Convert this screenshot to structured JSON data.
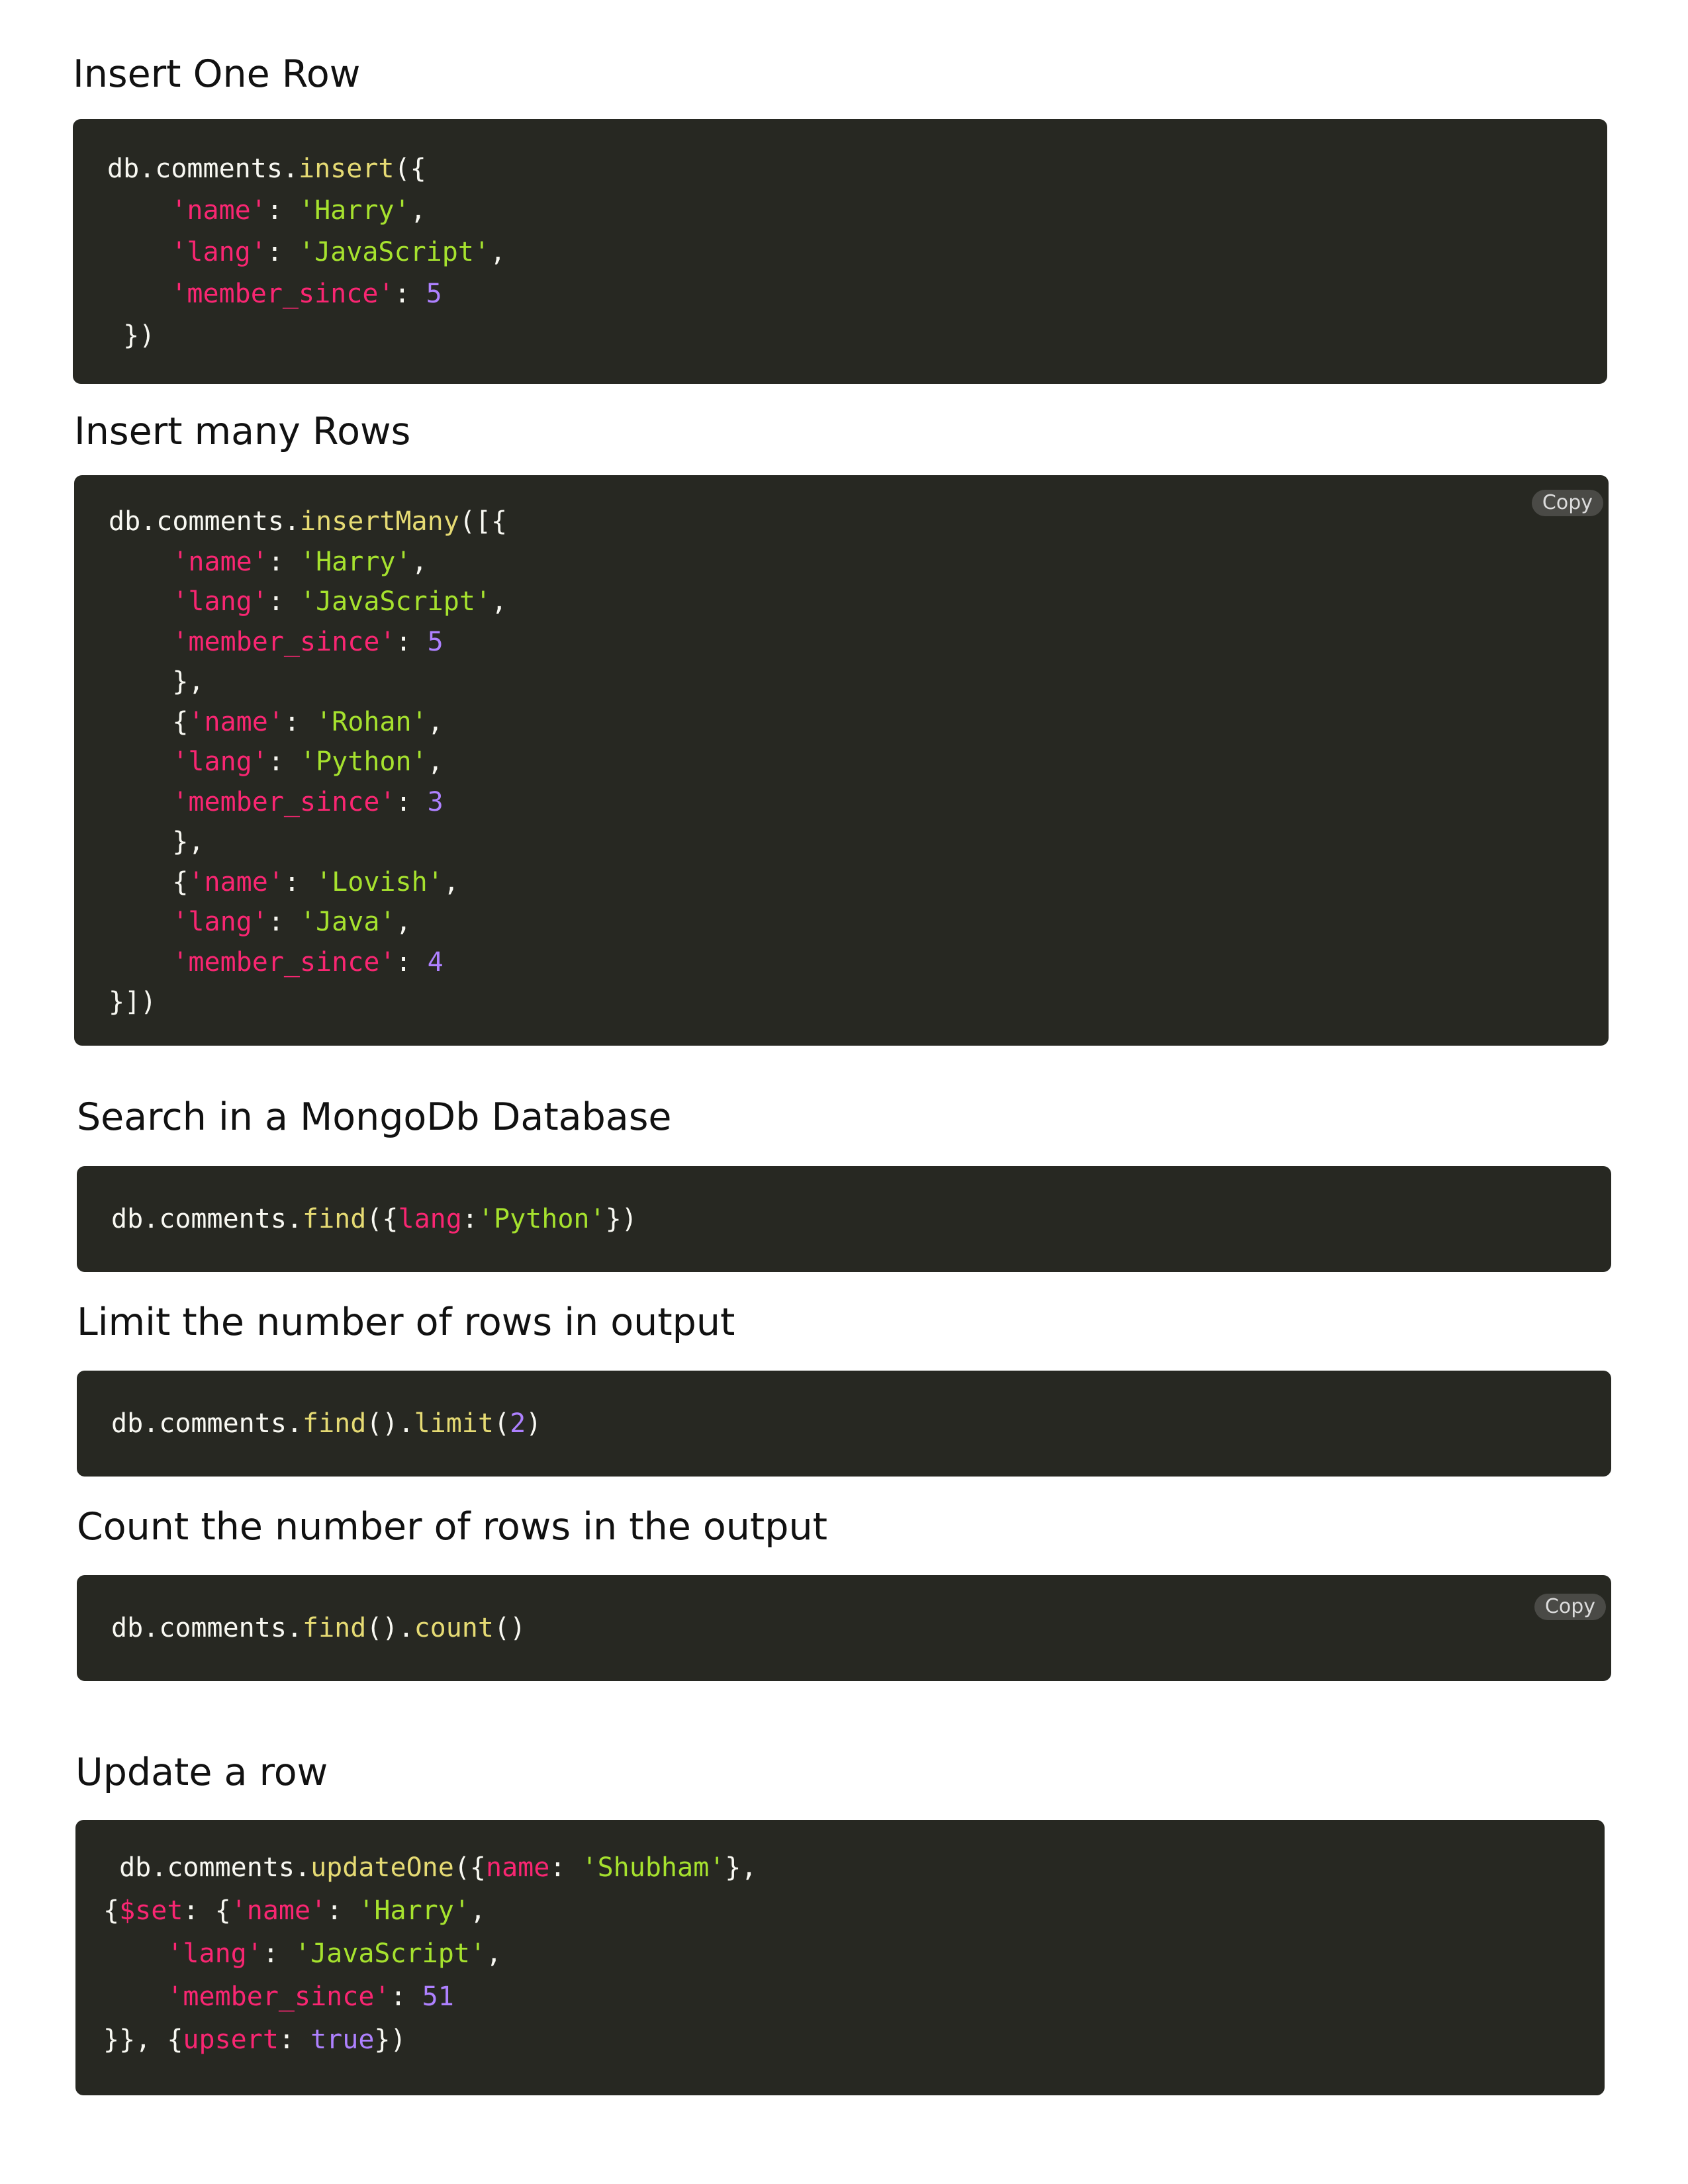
{
  "sections": [
    {
      "title": "Insert One Row",
      "lines": [
        [
          [
            "db.comments.",
            "plain"
          ],
          [
            "insert",
            "fn"
          ],
          [
            "({",
            "plain"
          ]
        ],
        [
          [
            "    ",
            "plain"
          ],
          [
            "'name'",
            "key"
          ],
          [
            ": ",
            "plain"
          ],
          [
            "'Harry'",
            "str"
          ],
          [
            ",",
            "plain"
          ]
        ],
        [
          [
            "    ",
            "plain"
          ],
          [
            "'lang'",
            "key"
          ],
          [
            ": ",
            "plain"
          ],
          [
            "'JavaScript'",
            "str"
          ],
          [
            ",",
            "plain"
          ]
        ],
        [
          [
            "    ",
            "plain"
          ],
          [
            "'member_since'",
            "key"
          ],
          [
            ": ",
            "plain"
          ],
          [
            "5",
            "num"
          ]
        ],
        [
          [
            " })",
            "plain"
          ]
        ]
      ]
    },
    {
      "title": "Insert many Rows",
      "copy_label": "Copy",
      "lines": [
        [
          [
            "db.comments.",
            "plain"
          ],
          [
            "insertMany",
            "fn"
          ],
          [
            "([{",
            "plain"
          ]
        ],
        [
          [
            "    ",
            "plain"
          ],
          [
            "'name'",
            "key"
          ],
          [
            ": ",
            "plain"
          ],
          [
            "'Harry'",
            "str"
          ],
          [
            ",",
            "plain"
          ]
        ],
        [
          [
            "    ",
            "plain"
          ],
          [
            "'lang'",
            "key"
          ],
          [
            ": ",
            "plain"
          ],
          [
            "'JavaScript'",
            "str"
          ],
          [
            ",",
            "plain"
          ]
        ],
        [
          [
            "    ",
            "plain"
          ],
          [
            "'member_since'",
            "key"
          ],
          [
            ": ",
            "plain"
          ],
          [
            "5",
            "num"
          ]
        ],
        [
          [
            "    },",
            "plain"
          ]
        ],
        [
          [
            "    {",
            "plain"
          ],
          [
            "'name'",
            "key"
          ],
          [
            ": ",
            "plain"
          ],
          [
            "'Rohan'",
            "str"
          ],
          [
            ",",
            "plain"
          ]
        ],
        [
          [
            "    ",
            "plain"
          ],
          [
            "'lang'",
            "key"
          ],
          [
            ": ",
            "plain"
          ],
          [
            "'Python'",
            "str"
          ],
          [
            ",",
            "plain"
          ]
        ],
        [
          [
            "    ",
            "plain"
          ],
          [
            "'member_since'",
            "key"
          ],
          [
            ": ",
            "plain"
          ],
          [
            "3",
            "num"
          ]
        ],
        [
          [
            "    },",
            "plain"
          ]
        ],
        [
          [
            "    {",
            "plain"
          ],
          [
            "'name'",
            "key"
          ],
          [
            ": ",
            "plain"
          ],
          [
            "'Lovish'",
            "str"
          ],
          [
            ",",
            "plain"
          ]
        ],
        [
          [
            "    ",
            "plain"
          ],
          [
            "'lang'",
            "key"
          ],
          [
            ": ",
            "plain"
          ],
          [
            "'Java'",
            "str"
          ],
          [
            ",",
            "plain"
          ]
        ],
        [
          [
            "    ",
            "plain"
          ],
          [
            "'member_since'",
            "key"
          ],
          [
            ": ",
            "plain"
          ],
          [
            "4",
            "num"
          ]
        ],
        [
          [
            "}])",
            "plain"
          ]
        ]
      ]
    },
    {
      "title": "Search in a MongoDb Database",
      "lines": [
        [
          [
            "db.comments.",
            "plain"
          ],
          [
            "find",
            "fn"
          ],
          [
            "({",
            "plain"
          ],
          [
            "lang",
            "key"
          ],
          [
            ":",
            "plain"
          ],
          [
            "'Python'",
            "str"
          ],
          [
            "})",
            "plain"
          ]
        ]
      ]
    },
    {
      "title": "Limit the number of rows in output",
      "lines": [
        [
          [
            "db.comments.",
            "plain"
          ],
          [
            "find",
            "fn"
          ],
          [
            "().",
            "plain"
          ],
          [
            "limit",
            "fn"
          ],
          [
            "(",
            "plain"
          ],
          [
            "2",
            "num"
          ],
          [
            ")",
            "plain"
          ]
        ]
      ]
    },
    {
      "title": "Count the number of rows in the output",
      "copy_label": "Copy",
      "lines": [
        [
          [
            "db.comments.",
            "plain"
          ],
          [
            "find",
            "fn"
          ],
          [
            "().",
            "plain"
          ],
          [
            "count",
            "fn"
          ],
          [
            "()",
            "plain"
          ]
        ]
      ]
    },
    {
      "title": "Update a row",
      "lines": [
        [
          [
            " db.comments.",
            "plain"
          ],
          [
            "updateOne",
            "fn"
          ],
          [
            "({",
            "plain"
          ],
          [
            "name",
            "key"
          ],
          [
            ": ",
            "plain"
          ],
          [
            "'Shubham'",
            "str"
          ],
          [
            "},",
            "plain"
          ]
        ],
        [
          [
            "{",
            "plain"
          ],
          [
            "$set",
            "key"
          ],
          [
            ": {",
            "plain"
          ],
          [
            "'name'",
            "key"
          ],
          [
            ": ",
            "plain"
          ],
          [
            "'Harry'",
            "str"
          ],
          [
            ",",
            "plain"
          ]
        ],
        [
          [
            "    ",
            "plain"
          ],
          [
            "'lang'",
            "key"
          ],
          [
            ": ",
            "plain"
          ],
          [
            "'JavaScript'",
            "str"
          ],
          [
            ",",
            "plain"
          ]
        ],
        [
          [
            "    ",
            "plain"
          ],
          [
            "'member_since'",
            "key"
          ],
          [
            ": ",
            "plain"
          ],
          [
            "51",
            "num"
          ]
        ],
        [
          [
            "}}, {",
            "plain"
          ],
          [
            "upsert",
            "key"
          ],
          [
            ": ",
            "plain"
          ],
          [
            "true",
            "num"
          ],
          [
            "})",
            "plain"
          ]
        ]
      ]
    }
  ]
}
